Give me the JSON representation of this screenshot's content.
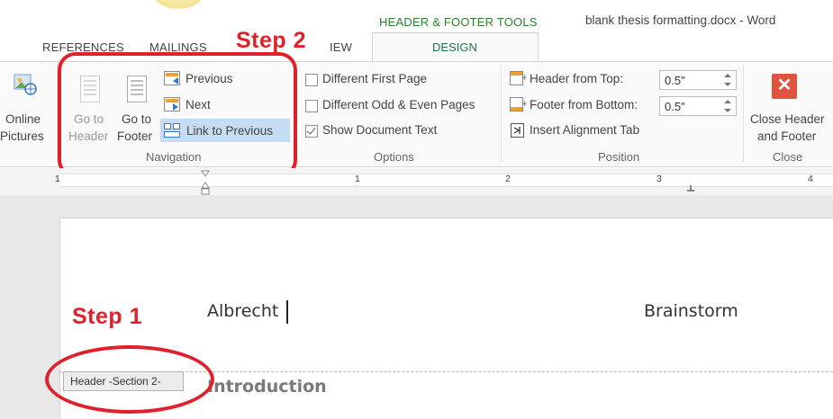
{
  "title_bar": {
    "tool_context": "HEADER & FOOTER TOOLS",
    "document_title": "blank thesis formatting.docx - Word"
  },
  "tabs": {
    "references": "REFERENCES",
    "mailings": "MAILINGS",
    "review_partial": "IEW",
    "design": "DESIGN"
  },
  "ribbon": {
    "online_pictures": {
      "line1": "Online",
      "line2": "Pictures"
    },
    "navigation": {
      "go_to_header": {
        "line1": "Go to",
        "line2": "Header"
      },
      "go_to_footer": {
        "line1": "Go to",
        "line2": "Footer"
      },
      "previous": "Previous",
      "next": "Next",
      "link_to_previous": "Link to Previous",
      "group_label": "Navigation"
    },
    "options": {
      "different_first_page": "Different First Page",
      "different_odd_even": "Different Odd & Even Pages",
      "show_document_text": "Show Document Text",
      "group_label": "Options",
      "different_first_page_checked": false,
      "different_odd_even_checked": false,
      "show_document_text_checked": true
    },
    "position": {
      "header_from_top_label": "Header from Top:",
      "header_from_top_value": "0.5\"",
      "footer_from_bottom_label": "Footer from Bottom:",
      "footer_from_bottom_value": "0.5\"",
      "insert_alignment_tab": "Insert Alignment Tab",
      "group_label": "Position"
    },
    "close": {
      "close_line1": "Close Header",
      "close_line2": "and Footer",
      "group_label": "Close"
    }
  },
  "annotations": {
    "step1": "Step 1",
    "step2": "Step 2",
    "color": "#e0202a"
  },
  "ruler": {
    "numbers": [
      "1",
      "1",
      "2",
      "3",
      "4"
    ]
  },
  "document": {
    "header_left": "Albrecht",
    "header_right": "Brainstorm",
    "header_tag": "Header -Section 2-",
    "body_heading": "Introduction"
  }
}
